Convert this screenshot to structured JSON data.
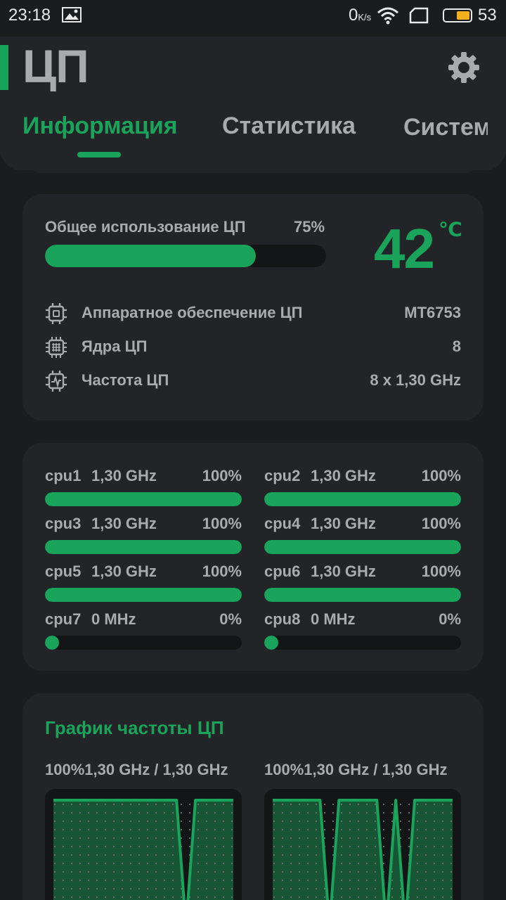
{
  "status_bar": {
    "time": "23:18",
    "net_speed_value": "0",
    "net_speed_unit": "K/s",
    "battery_percent": "53"
  },
  "header": {
    "title": "ЦП",
    "tabs": [
      {
        "label": "Информация",
        "active": true
      },
      {
        "label": "Статистика",
        "active": false
      },
      {
        "label": "Система",
        "active": false
      }
    ]
  },
  "overview": {
    "usage_label": "Общее использование ЦП",
    "usage_percent_text": "75%",
    "usage_percent": 75,
    "temperature": "42",
    "temperature_unit": "℃",
    "rows": [
      {
        "icon": "chip-icon",
        "label": "Аппаратное обеспечение ЦП",
        "value": "MT6753"
      },
      {
        "icon": "cores-icon",
        "label": "Ядра ЦП",
        "value": "8"
      },
      {
        "icon": "frequency-icon",
        "label": "Частота ЦП",
        "value": "8 x 1,30 GHz"
      }
    ]
  },
  "cores": [
    {
      "name": "cpu1",
      "freq": "1,30 GHz",
      "pct_text": "100%",
      "pct": 100
    },
    {
      "name": "cpu2",
      "freq": "1,30 GHz",
      "pct_text": "100%",
      "pct": 100
    },
    {
      "name": "cpu3",
      "freq": "1,30 GHz",
      "pct_text": "100%",
      "pct": 100
    },
    {
      "name": "cpu4",
      "freq": "1,30 GHz",
      "pct_text": "100%",
      "pct": 100
    },
    {
      "name": "cpu5",
      "freq": "1,30 GHz",
      "pct_text": "100%",
      "pct": 100
    },
    {
      "name": "cpu6",
      "freq": "1,30 GHz",
      "pct_text": "100%",
      "pct": 100
    },
    {
      "name": "cpu7",
      "freq": "0 MHz",
      "pct_text": "0%",
      "pct": 0
    },
    {
      "name": "cpu8",
      "freq": "0 MHz",
      "pct_text": "0%",
      "pct": 0
    }
  ],
  "freq_chart": {
    "title": "График частоты ЦП",
    "graphs": [
      {
        "label": "100%1,30 GHz / 1,30 GHz",
        "samples": [
          1,
          1,
          1,
          1,
          1,
          1,
          1,
          1,
          1,
          1,
          1,
          1,
          1,
          1,
          0,
          1,
          1,
          1,
          1,
          1
        ]
      },
      {
        "label": "100%1,30 GHz / 1,30 GHz",
        "samples": [
          1,
          1,
          1,
          1,
          1,
          1,
          0,
          1,
          1,
          1,
          1,
          1,
          0,
          1,
          0,
          1,
          1,
          1,
          1,
          1
        ]
      }
    ]
  },
  "colors": {
    "accent": "#1aa35a",
    "card": "#232427",
    "background": "#1b1c1e",
    "track": "#141517",
    "text": "#a9abae"
  }
}
